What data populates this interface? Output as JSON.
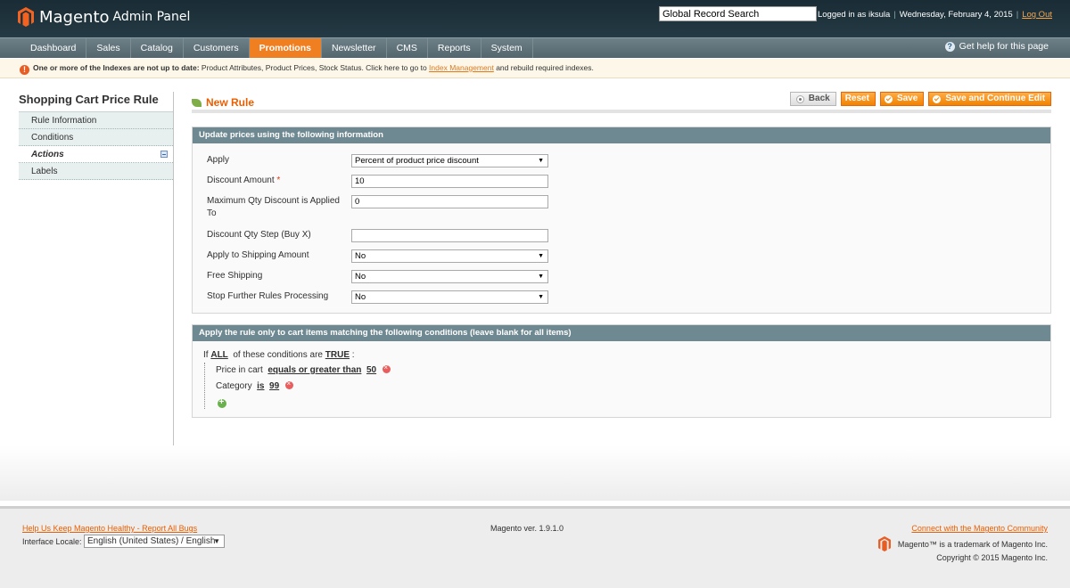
{
  "header": {
    "brand": "Magento",
    "sub": "Admin Panel",
    "search_value": "Global Record Search",
    "logged_in": "Logged in as iksula",
    "date": "Wednesday, February 4, 2015",
    "logout": "Log Out"
  },
  "nav": {
    "items": [
      "Dashboard",
      "Sales",
      "Catalog",
      "Customers",
      "Promotions",
      "Newsletter",
      "CMS",
      "Reports",
      "System"
    ],
    "active": "Promotions",
    "help": "Get help for this page"
  },
  "notice": {
    "bold": "One or more of the Indexes are not up to date:",
    "text": " Product Attributes, Product Prices, Stock Status. Click here to go to ",
    "link": "Index Management",
    "after": " and rebuild required indexes."
  },
  "sidebar": {
    "title": "Shopping Cart Price Rule",
    "tabs": [
      "Rule Information",
      "Conditions",
      "Actions",
      "Labels"
    ],
    "active": "Actions"
  },
  "page": {
    "title": "New Rule",
    "buttons": {
      "back": "Back",
      "reset": "Reset",
      "save": "Save",
      "save_continue": "Save and Continue Edit"
    }
  },
  "actions": {
    "header": "Update prices using the following information",
    "apply_label": "Apply",
    "apply_value": "Percent of product price discount",
    "discount_label": "Discount Amount",
    "discount_value": "10",
    "maxqty_label": "Maximum Qty Discount is Applied To",
    "maxqty_value": "0",
    "step_label": "Discount Qty Step (Buy X)",
    "step_value": "",
    "shipping_label": "Apply to Shipping Amount",
    "shipping_value": "No",
    "free_label": "Free Shipping",
    "free_value": "No",
    "stop_label": "Stop Further Rules Processing",
    "stop_value": "No"
  },
  "conditions": {
    "header": "Apply the rule only to cart items matching the following conditions (leave blank for all items)",
    "if": "If",
    "all": "ALL",
    "mid": "of these conditions are",
    "true": "TRUE",
    "colon": ":",
    "c1_attr": "Price in cart",
    "c1_op": "equals or greater than",
    "c1_val": "50",
    "c2_attr": "Category",
    "c2_op": "is",
    "c2_val": "99"
  },
  "footer": {
    "bugs": "Help Us Keep Magento Healthy - Report All Bugs",
    "locale_label": "Interface Locale:",
    "locale_value": "English (United States) / English",
    "version": "Magento ver. 1.9.1.0",
    "community": "Connect with the Magento Community",
    "trademark": "Magento™ is a trademark of Magento Inc.",
    "copyright": "Copyright © 2015 Magento Inc."
  },
  "colors": {
    "accent": "#f07f22",
    "header_bg": "#1a2c35",
    "fieldset_head": "#6f8992",
    "title": "#eb5e00"
  }
}
